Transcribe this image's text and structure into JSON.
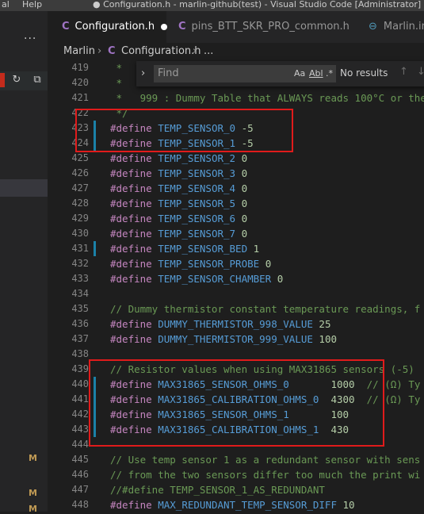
{
  "titlebar": {
    "menu_view": "al",
    "menu_help": "Help",
    "window_title": "● Configuration.h - marlin-github(test) - Visual Studio Code [Administrator]"
  },
  "sidebar": {
    "more": "···",
    "modified_badges": [
      "M",
      "M",
      "M"
    ]
  },
  "tabs": [
    {
      "label": "Configuration.h",
      "icon": "C",
      "active": true,
      "dirty": true
    },
    {
      "label": "pins_BTT_SKR_PRO_common.h",
      "icon": "C"
    },
    {
      "label": "Marlin.ino",
      "icon": "hash"
    }
  ],
  "breadcrumb": {
    "folder": "Marlin",
    "file_icon": "C",
    "file": "Configuration.h",
    "more": "..."
  },
  "find": {
    "placeholder": "Find",
    "match_case": "Aa",
    "whole_word": "Abl",
    "regex": ".*",
    "results": "No results",
    "up": "↑",
    "down": "↓"
  },
  "code": {
    "line_numbers": [
      "419",
      "420",
      "421",
      "422",
      "423",
      "424",
      "425",
      "426",
      "427",
      "428",
      "429",
      "430",
      "431",
      "432",
      "433",
      "434",
      "435",
      "436",
      "437",
      "438",
      "439",
      "440",
      "441",
      "442",
      "443",
      "444",
      "445",
      "446",
      "447",
      "448"
    ],
    "lines": [
      {
        "c": " *"
      },
      {
        "c": " *"
      },
      {
        "c": " *   999 : Dummy Table that ALWAYS reads 100°C or the"
      },
      {
        "c": " */"
      },
      {
        "k": "#define",
        "m": "TEMP_SENSOR_0",
        "v": "-5"
      },
      {
        "k": "#define",
        "m": "TEMP_SENSOR_1",
        "v": "-5"
      },
      {
        "k": "#define",
        "m": "TEMP_SENSOR_2",
        "v": "0"
      },
      {
        "k": "#define",
        "m": "TEMP_SENSOR_3",
        "v": "0"
      },
      {
        "k": "#define",
        "m": "TEMP_SENSOR_4",
        "v": "0"
      },
      {
        "k": "#define",
        "m": "TEMP_SENSOR_5",
        "v": "0"
      },
      {
        "k": "#define",
        "m": "TEMP_SENSOR_6",
        "v": "0"
      },
      {
        "k": "#define",
        "m": "TEMP_SENSOR_7",
        "v": "0"
      },
      {
        "k": "#define",
        "m": "TEMP_SENSOR_BED",
        "v": "1"
      },
      {
        "k": "#define",
        "m": "TEMP_SENSOR_PROBE",
        "v": "0"
      },
      {
        "k": "#define",
        "m": "TEMP_SENSOR_CHAMBER",
        "v": "0"
      },
      {},
      {
        "c": "// Dummy thermistor constant temperature readings, f"
      },
      {
        "k": "#define",
        "m": "DUMMY_THERMISTOR_998_VALUE",
        "v": "25"
      },
      {
        "k": "#define",
        "m": "DUMMY_THERMISTOR_999_VALUE",
        "v": "100"
      },
      {},
      {
        "c": "// Resistor values when using MAX31865 sensors (-5)"
      },
      {
        "k": "#define",
        "m": "MAX31865_SENSOR_OHMS_0",
        "v": "1000",
        "pad": "      ",
        "t": "  // (Ω) Ty"
      },
      {
        "k": "#define",
        "m": "MAX31865_CALIBRATION_OHMS_0",
        "v": "4300",
        "pad": " ",
        "t": "  // (Ω) Ty"
      },
      {
        "k": "#define",
        "m": "MAX31865_SENSOR_OHMS_1",
        "v": "100",
        "pad": "      "
      },
      {
        "k": "#define",
        "m": "MAX31865_CALIBRATION_OHMS_1",
        "v": "430",
        "pad": " "
      },
      {},
      {
        "c": "// Use temp sensor 1 as a redundant sensor with sens"
      },
      {
        "c": "// from the two sensors differ too much the print wi"
      },
      {
        "c": "//#define TEMP_SENSOR_1_AS_REDUNDANT"
      },
      {
        "k": "#define",
        "m": "MAX_REDUNDANT_TEMP_SENSOR_DIFF",
        "v": "10"
      }
    ]
  },
  "colors": {
    "editor_bg": "#1e1e1e",
    "keyword": "#c586c0",
    "macro": "#569cd6",
    "number": "#b5cea8",
    "comment": "#6a9955",
    "highlight_box": "#e01b1b",
    "modified_bar": "#1b81a8"
  }
}
